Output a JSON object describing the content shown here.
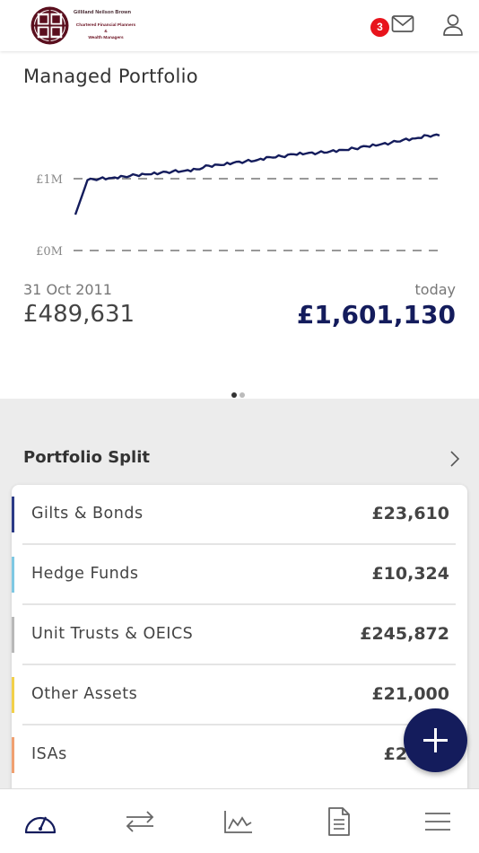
{
  "header": {
    "logo": {
      "firm_name": "Gilliland Neilson Brown",
      "tagline_1": "Chartered Financial Planners",
      "tagline_2": "&",
      "tagline_3": "Wealth Managers"
    },
    "notification_count": "3",
    "icons": [
      "mail-icon",
      "user-icon"
    ]
  },
  "portfolio": {
    "title": "Managed Portfolio",
    "start_date": "31 Oct 2011",
    "start_value": "£489,631",
    "end_label": "today",
    "end_value": "£1,601,130",
    "pager": {
      "pages": 2,
      "active": 0
    }
  },
  "chart_data": {
    "type": "line",
    "title": "",
    "xlabel": "",
    "ylabel": "",
    "y_tick_labels": [
      "£1M",
      "£0M"
    ],
    "y_ticks": [
      1000000,
      0
    ],
    "ylim": [
      0,
      1300000
    ],
    "grid": "dashed lines at £0M and £1M",
    "line_color": "#141c5c",
    "series": [
      {
        "values": [
          500000,
          980000,
          1000000,
          1010000,
          1030000,
          1050000,
          1060000,
          1080000,
          1100000,
          1110000,
          1130000,
          1180000,
          1190000,
          1220000,
          1240000,
          1260000,
          1300000,
          1310000,
          1340000,
          1350000,
          1360000,
          1380000,
          1400000,
          1420000,
          1450000,
          1470000,
          1500000,
          1540000,
          1560000,
          1600000,
          1601130
        ]
      }
    ]
  },
  "split": {
    "title": "Portfolio Split",
    "rows": [
      {
        "label": "Gilts & Bonds",
        "value": "£23,610",
        "color": "#2b3a86"
      },
      {
        "label": "Hedge Funds",
        "value": "£10,324",
        "color": "#7ec8e3"
      },
      {
        "label": "Unit Trusts & OEICS",
        "value": "£245,872",
        "color": "#b8b8b8"
      },
      {
        "label": "Other Assets",
        "value": "£21,000",
        "color": "#f2d04a"
      },
      {
        "label": "ISAs",
        "value": "£240,9",
        "color": "#f0a070"
      }
    ]
  },
  "fab": {
    "icon": "plus-icon"
  },
  "nav": {
    "items": [
      "dashboard-gauge-icon",
      "transfer-arrows-icon",
      "performance-chart-icon",
      "document-icon",
      "menu-icon"
    ]
  },
  "colors": {
    "accent": "#141c5c",
    "badge": "#e8141c",
    "logo_maroon": "#6a1020"
  }
}
